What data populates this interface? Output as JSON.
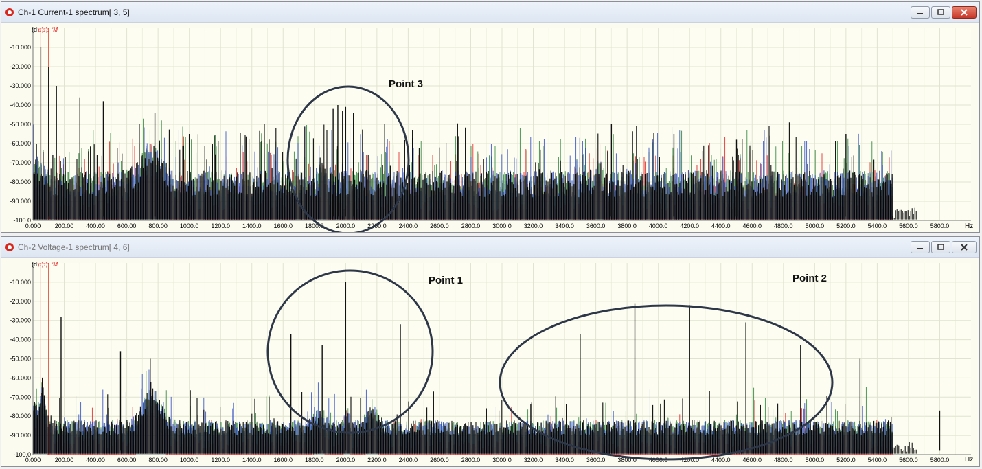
{
  "windows": [
    {
      "title": "Ch-1 Current-1 spectrum[ 3, 5]",
      "y_unit": "(d",
      "marker_labels": "'p'p'p 'ʹM",
      "y_ticks": [
        "-10.000",
        "-20.000",
        "-30.000",
        "-40.000",
        "-50.000",
        "-60.000",
        "-70.000",
        "-80.000",
        "-90.000",
        "-100.0"
      ],
      "x_ticks": [
        "0.000",
        "200.00",
        "400.00",
        "600.00",
        "800.00",
        "1000.0",
        "1200.0",
        "1400.0",
        "1600.0",
        "1800.0",
        "2000.0",
        "2200.0",
        "2400.0",
        "2600.0",
        "2800.0",
        "3000.0",
        "3200.0",
        "3400.0",
        "3600.0",
        "3800.0",
        "4000.0",
        "4200.0",
        "4400.0",
        "4600.0",
        "4800.0",
        "5000.0",
        "5200.0",
        "5400.0",
        "5600.0",
        "5800.0"
      ],
      "x_unit": "Hz",
      "annotations": [
        {
          "label": "Point 3"
        }
      ]
    },
    {
      "title": "Ch-2 Voltage-1 spectrum[ 4, 6]",
      "y_unit": "(d",
      "marker_labels": "'p'p'p 'ʹM",
      "y_ticks": [
        "-10.000",
        "-20.000",
        "-30.000",
        "-40.000",
        "-50.000",
        "-60.000",
        "-70.000",
        "-80.000",
        "-90.000",
        "-100.0"
      ],
      "x_ticks": [
        "0.000",
        "200.00",
        "400.00",
        "600.00",
        "800.00",
        "1000.0",
        "1200.0",
        "1400.0",
        "1600.0",
        "1800.0",
        "2000.0",
        "2200.0",
        "2400.0",
        "2600.0",
        "2800.0",
        "3000.0",
        "3200.0",
        "3400.0",
        "3600.0",
        "3800.0",
        "4000.0",
        "4200.0",
        "4400.0",
        "4600.0",
        "4800.0",
        "5000.0",
        "5200.0",
        "5400.0",
        "5600.0",
        "5800.0"
      ],
      "x_unit": "Hz",
      "annotations": [
        {
          "label": "Point 1"
        },
        {
          "label": "Point 2"
        }
      ]
    }
  ],
  "chart_data": [
    {
      "type": "line",
      "xlim": [
        0,
        6000
      ],
      "ylim": [
        -100,
        0
      ],
      "grid": true,
      "series_colors": [
        "#000000",
        "#1f3fbf",
        "#1a7a2a",
        "#e01010"
      ],
      "noise_floor_dB": -88,
      "cutoff_Hz": 5500,
      "peaks_Hz_dB": [
        [
          50,
          -10
        ],
        [
          100,
          -20
        ],
        [
          150,
          -30
        ],
        [
          300,
          -36
        ],
        [
          450,
          -38
        ],
        [
          680,
          -50
        ],
        [
          780,
          -44
        ],
        [
          1000,
          -55
        ],
        [
          1920,
          -42
        ],
        [
          1950,
          -40
        ],
        [
          1980,
          -43
        ],
        [
          2000,
          -41
        ],
        [
          2050,
          -44
        ],
        [
          2250,
          -50
        ],
        [
          3700,
          -50
        ],
        [
          4100,
          -55
        ],
        [
          4500,
          -58
        ],
        [
          5200,
          -55
        ]
      ],
      "annotations": [
        {
          "center_Hz_dB": [
            2000,
            -60
          ],
          "label": "Point 3"
        }
      ]
    },
    {
      "type": "line",
      "xlim": [
        0,
        6000
      ],
      "ylim": [
        -100,
        0
      ],
      "grid": true,
      "series_colors": [
        "#000000",
        "#1f3fbf",
        "#1a7a2a",
        "#e01010"
      ],
      "noise_floor_dB": -90,
      "cutoff_Hz": 5500,
      "peaks_Hz_dB": [
        [
          180,
          -28
        ],
        [
          560,
          -46
        ],
        [
          750,
          -50
        ],
        [
          1650,
          -37
        ],
        [
          1850,
          -43
        ],
        [
          2000,
          -10
        ],
        [
          2350,
          -32
        ],
        [
          3500,
          -37
        ],
        [
          3850,
          -21
        ],
        [
          4200,
          -22
        ],
        [
          4560,
          -31
        ],
        [
          4910,
          -43
        ],
        [
          5290,
          -50
        ],
        [
          5800,
          -77
        ]
      ],
      "annotations": [
        {
          "center_Hz_dB": [
            2000,
            -60
          ],
          "label": "Point 1"
        },
        {
          "center_Hz_dB": [
            4200,
            -60
          ],
          "label": "Point 2"
        }
      ]
    }
  ]
}
